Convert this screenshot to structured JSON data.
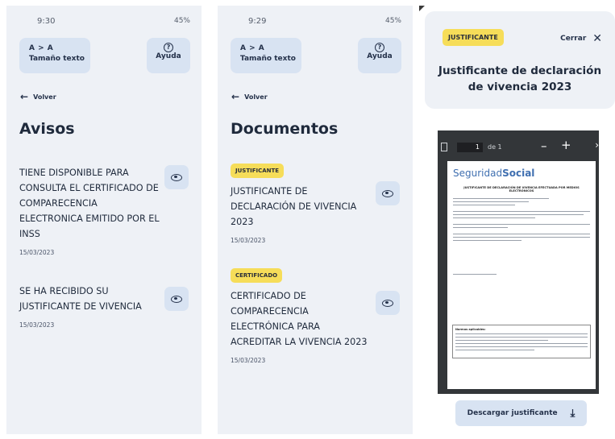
{
  "screen1": {
    "status_time": "9:30",
    "status_right": "45%",
    "text_size_icon": "A > A",
    "text_size_label": "Tamaño texto",
    "help_label": "Ayuda",
    "back_label": "Volver",
    "title": "Avisos",
    "items": [
      {
        "text": "TIENE DISPONIBLE PARA CONSULTA EL CERTIFICADO DE COMPARECENCIA ELECTRONICA EMITIDO POR EL INSS",
        "date": "15/03/2023"
      },
      {
        "text": "SE HA RECIBIDO SU JUSTIFICANTE DE VIVENCIA",
        "date": "15/03/2023"
      }
    ]
  },
  "screen2": {
    "status_time": "9:29",
    "status_right": "45%",
    "text_size_icon": "A > A",
    "text_size_label": "Tamaño texto",
    "help_label": "Ayuda",
    "back_label": "Volver",
    "title": "Documentos",
    "items": [
      {
        "badge": "JUSTIFICANTE",
        "text": "JUSTIFICANTE DE DECLARACIÓN DE VIVENCIA 2023",
        "date": "15/03/2023"
      },
      {
        "badge": "CERTIFICADO",
        "text": "CERTIFICADO DE COMPARECENCIA ELECTRÓNICA PARA ACREDITAR LA VIVENCIA 2023",
        "date": "15/03/2023"
      }
    ]
  },
  "screen3": {
    "badge": "JUSTIFICANTE",
    "close_label": "Cerrar",
    "title": "Justificante de declaración de vivencia 2023",
    "viewer": {
      "page": "1",
      "page_of": "de 1",
      "logo_light": "Seguridad",
      "logo_bold": "Social",
      "doc_heading": "JUSTIFICANTE DE DECLARACIÓN DE VIVENCIA EFECTUADA POR MEDIOS ELECTRÓNICOS",
      "box_title": "Normas aplicables:"
    },
    "download_label": "Descargar justificante"
  },
  "colors": {
    "badge_yellow": "#f6dd59",
    "button_blue": "#d8e3f2",
    "screen_bg": "#eef1f6",
    "viewer_dark": "#333639"
  }
}
